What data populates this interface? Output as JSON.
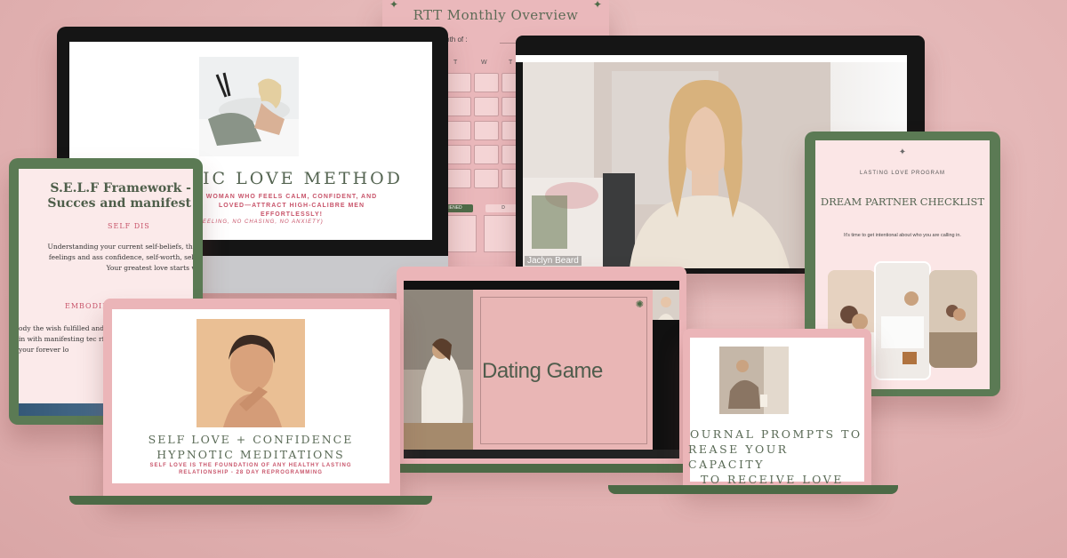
{
  "planner": {
    "title": "RTT Monthly Overview",
    "month_label": "Month of :",
    "day_labels": [
      "T",
      "W",
      "T"
    ],
    "pill_labels": [
      "IENED",
      "D"
    ]
  },
  "monitor_left": {
    "heading": "IC LOVE METHOD",
    "subtitle": "WOMAN WHO FEELS CALM, CONFIDENT, AND LOVED—ATTRACT HIGH-CALIBRE MEN EFFORTLESSLY!",
    "tagline": "EELING, NO CHASING, NO ANXIETY)"
  },
  "video_call": {
    "name_tag": "Jaclyn Beard"
  },
  "tablet_left": {
    "title": "S.E.L.F Framework - Succes and manifest",
    "section1": "SELF DIS",
    "paragraph1": "Understanding your current self-beliefs, thoughts, feelings and ass confidence, self-worth, self-accep Your greatest love starts with SE",
    "section2": "EMBODIMENT",
    "paragraph2": "ody the wish fulfilled and get alling in with manifesting tec rfully attract your forever lo"
  },
  "tablet_right": {
    "eyebrow": "LASTING LOVE PROGRAM",
    "title": "DREAM PARTNER CHECKLIST",
    "body": "It's time to get intentional about who you are calling in."
  },
  "laptop_left": {
    "title_line1": "SELF LOVE + CONFIDENCE",
    "title_line2": "HYPNOTIC MEDITATIONS",
    "subtitle": "SELF LOVE IS THE FOUNDATION OF ANY HEALTHY LASTING RELATIONSHIP - 28 DAY REPROGRAMMING"
  },
  "laptop_middle": {
    "slide_title": "Dating Game"
  },
  "laptop_right": {
    "line1": "OURNAL PROMPTS TO",
    "line2": "REASE YOUR CAPACITY",
    "line3": "TO RECEIVE LOVE"
  },
  "colors": {
    "background": "#e2b2b2",
    "green": "#4c6a46",
    "pink": "#ebb5b8",
    "accent_text": "#c8546a"
  }
}
